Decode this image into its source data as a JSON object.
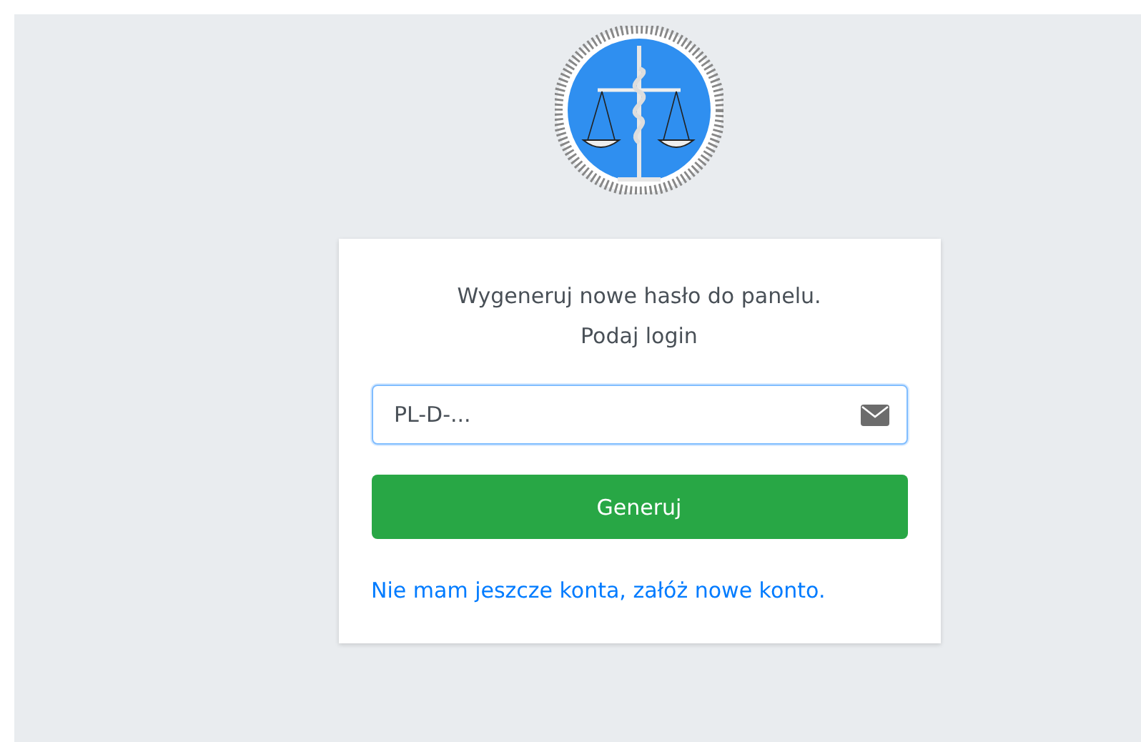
{
  "form": {
    "lines": [
      "Wygeneruj nowe hasło do panelu.",
      "Podaj login"
    ],
    "login_field": {
      "placeholder": "PL-D-..."
    },
    "submit_button": "Generuj",
    "register_link": "Nie mam jeszcze konta, załóż nowe konto."
  }
}
